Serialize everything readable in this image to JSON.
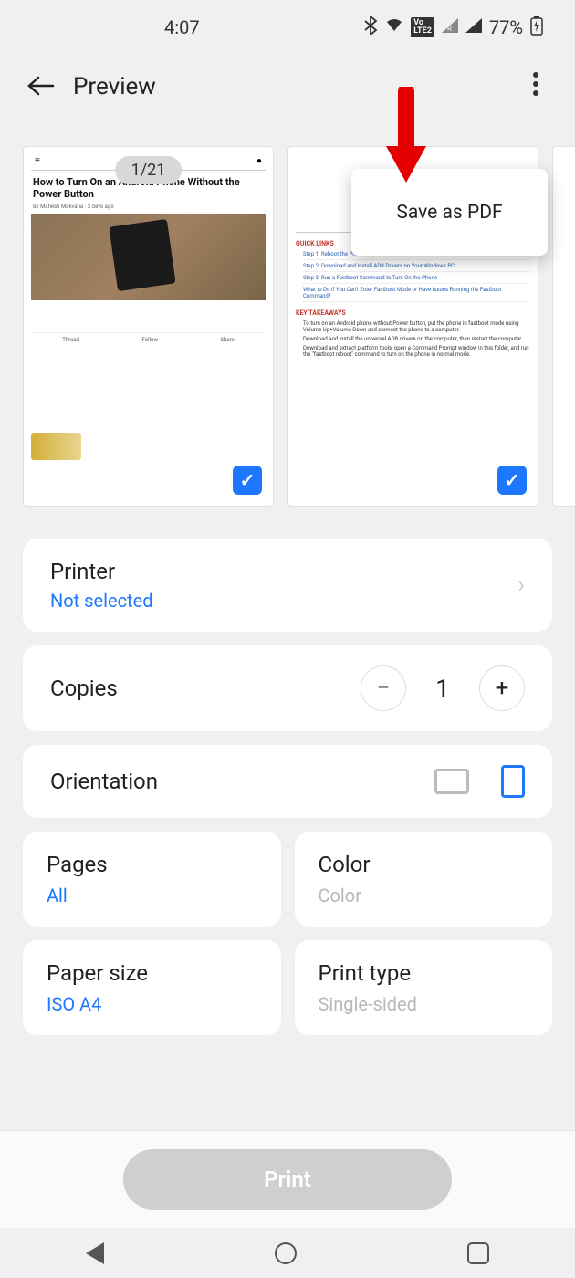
{
  "status": {
    "time": "4:07",
    "battery": "77%"
  },
  "header": {
    "title": "Preview"
  },
  "popup": {
    "label": "Save as PDF"
  },
  "pages": {
    "counter": "1/21",
    "thumb1": {
      "headline": "How to Turn On an Android Phone Without the Power Button",
      "action_thread": "Thread",
      "action_follow": "Follow",
      "action_share": "Share"
    },
    "thumb2": {
      "quick_links": "QUICK LINKS",
      "step1": "Step 1. Reboot the Phone in Fastboot Mode",
      "step2": "Step 2. Download and Install ADB Drivers on Your Windows PC",
      "step3": "Step 3. Run a Fastboot Command to Turn On the Phone",
      "step4": "What to Do if You Can't Enter Fastboot Mode or Have Issues Running the Fastboot Command?",
      "key_takeaways": "KEY TAKEAWAYS",
      "k1": "To turn on an Android phone without Power button, put the phone in fastboot mode using Volume Up+Volume Down and connect the phone to a computer.",
      "k2": "Download and install the universal ADB drivers on the computer, then restart the computer.",
      "k3": "Download and extract platform tools, open a Command Prompt window in this folder, and run the \"fastboot reboot\" command to turn on the phone in normal mode."
    }
  },
  "settings": {
    "printer": {
      "label": "Printer",
      "value": "Not selected"
    },
    "copies": {
      "label": "Copies",
      "value": "1"
    },
    "orientation": {
      "label": "Orientation"
    },
    "pages": {
      "label": "Pages",
      "value": "All"
    },
    "color": {
      "label": "Color",
      "value": "Color"
    },
    "paper_size": {
      "label": "Paper size",
      "value": "ISO A4"
    },
    "print_type": {
      "label": "Print type",
      "value": "Single-sided"
    }
  },
  "print_button": "Print"
}
